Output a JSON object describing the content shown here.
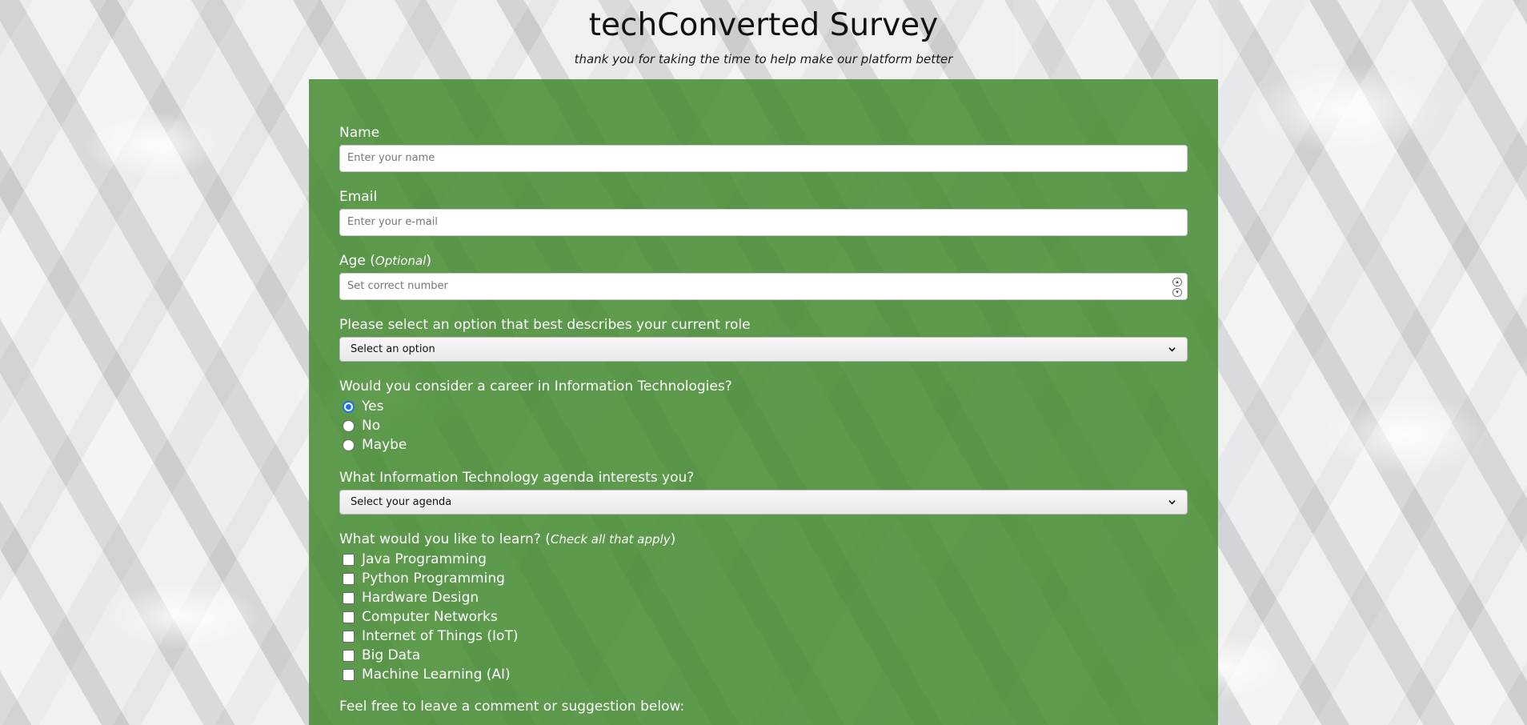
{
  "header": {
    "title": "techConverted Survey",
    "subtitle": "thank you for taking the time to help make our platform better"
  },
  "form": {
    "name": {
      "label": "Name",
      "placeholder": "Enter your name"
    },
    "email": {
      "label": "Email",
      "placeholder": "Enter your e-mail"
    },
    "age": {
      "label": "Age (",
      "label_optional": "Optional",
      "label_close": ")",
      "placeholder": "Set correct number"
    },
    "role": {
      "label": "Please select an option that best describes your current role",
      "selected": "Select an option"
    },
    "career": {
      "label": "Would you consider a career in Information Technologies?",
      "options": [
        "Yes",
        "No",
        "Maybe"
      ],
      "selected": "Yes"
    },
    "agenda": {
      "label": "What Information Technology agenda interests you?",
      "selected": "Select your agenda"
    },
    "learn": {
      "label": "What would you like to learn? (",
      "label_hint": "Check all that apply",
      "label_close": ")",
      "options": [
        "Java Programming",
        "Python Programming",
        "Hardware Design",
        "Computer Networks",
        "Internet of Things (IoT)",
        "Big Data",
        "Machine Learning (AI)"
      ]
    },
    "comment": {
      "label": "Feel free to leave a comment or suggestion below:"
    }
  },
  "colors": {
    "panel": "#438b2f",
    "radio_checked": "#1a73e8"
  },
  "icons": {
    "select_arrow": "chevron-down-icon",
    "spinner": "number-spinner"
  }
}
